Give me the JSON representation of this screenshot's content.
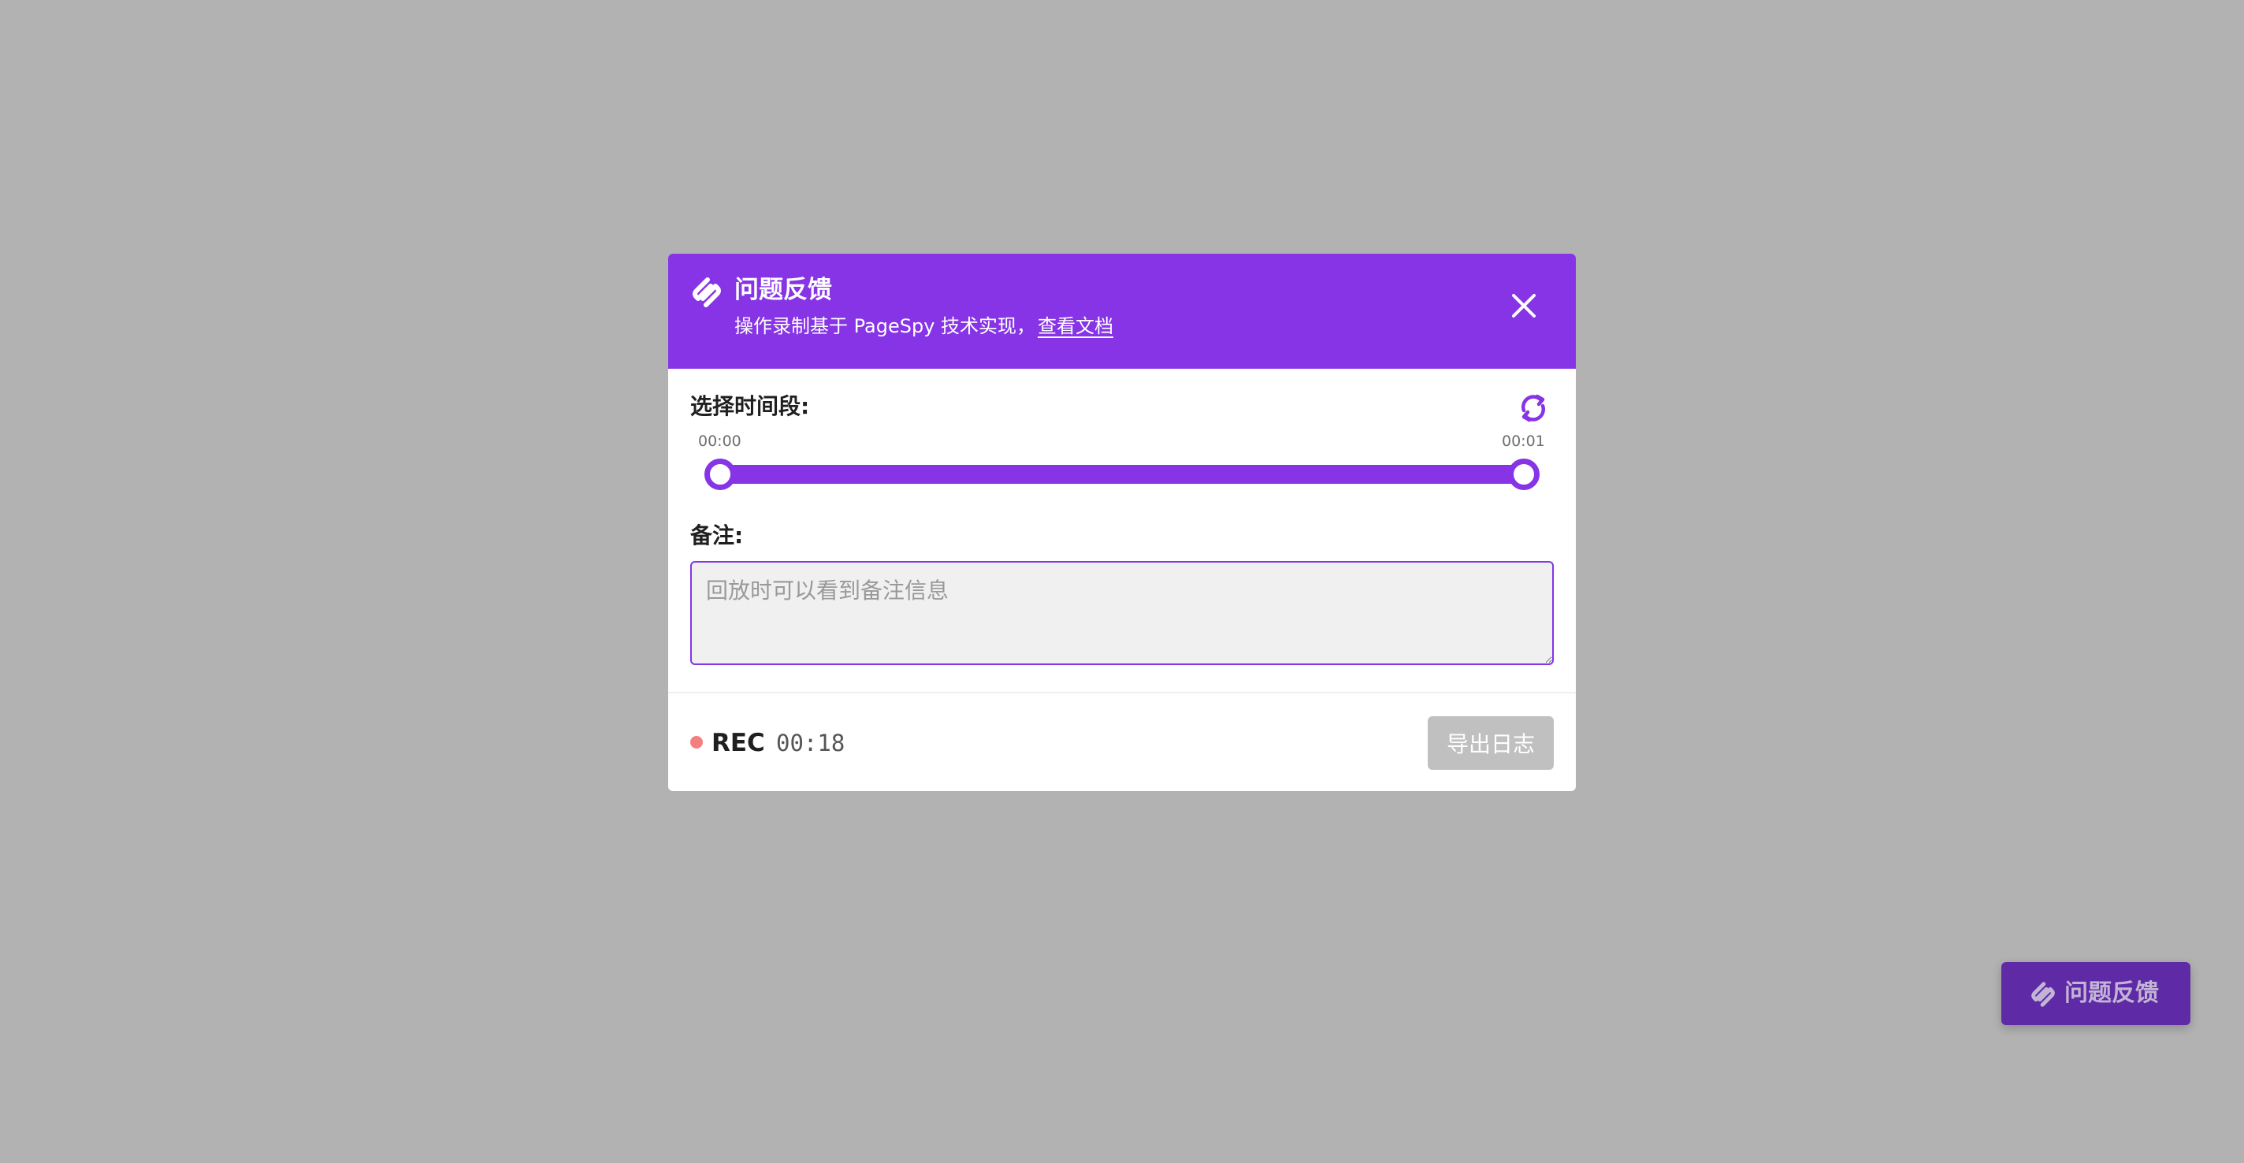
{
  "header": {
    "title": "问题反馈",
    "subtitle": "操作录制基于 PageSpy 技术实现，",
    "docs_link": "查看文档",
    "logo_icon": "pagespy-logo-icon",
    "close_icon": "close-icon"
  },
  "time_range": {
    "label": "选择时间段:",
    "start": "00:00",
    "end": "00:01",
    "selected_start_fraction": 0,
    "selected_end_fraction": 1,
    "reset_icon": "refresh-icon"
  },
  "remarks": {
    "label": "备注:",
    "value": "",
    "placeholder": "回放时可以看到备注信息"
  },
  "footer": {
    "rec_label": "REC",
    "rec_timer": "00:18",
    "export_label": "导出日志",
    "export_disabled": true
  },
  "floating_button": {
    "label": "问题反馈",
    "icon": "pagespy-logo-icon"
  },
  "colors": {
    "accent": "#8634e6",
    "overlay": "#b2b2b2",
    "recording_dot": "#f37f7f",
    "disabled_button": "#c0c0c0",
    "floating_button": "#5f2aa5"
  }
}
